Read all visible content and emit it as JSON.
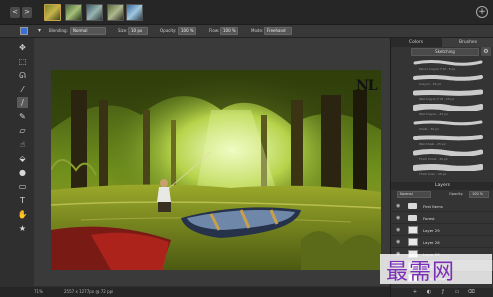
{
  "doc_strip": {
    "nav_left": "<",
    "nav_right": ">",
    "add_document": "+"
  },
  "options": {
    "blending_label": "Blending:",
    "blending_value": "Normal",
    "size_label": "Size:",
    "size_value": "10 px",
    "opacity_label": "Opacity:",
    "opacity_value": "100 %",
    "flow_label": "Flow:",
    "flow_value": "100 %",
    "mode_label": "Mode:",
    "mode_value": "Freehand",
    "accent_color": "#3a6fd8"
  },
  "tools": [
    "move-icon",
    "marquee-icon",
    "lasso-icon",
    "eyedropper-icon",
    "brush-icon",
    "pencil-icon",
    "eraser-icon",
    "smudge-icon",
    "fill-icon",
    "dodge-icon",
    "gradient-icon",
    "text-icon",
    "hand-icon",
    "star-icon"
  ],
  "status": {
    "zoom": "71%",
    "dimensions": "2557 x 1277px @ 72 ppi"
  },
  "panel": {
    "tabs": [
      "Colors",
      "Brushes"
    ],
    "active_tab": "Brushes",
    "brush_set": "Sketching",
    "brushes": [
      {
        "name": "Pencil Crayon F-M - 8 px"
      },
      {
        "name": "Crayon - 25 px"
      },
      {
        "name": "Wet Crayon F-M - 25 px"
      },
      {
        "name": "Wet Crayon - 25 px"
      },
      {
        "name": "Chalk - 30 px"
      },
      {
        "name": "Wet Chalk - 25 px"
      },
      {
        "name": "Thick Chalk - 30 px"
      },
      {
        "name": "Thick Crax - 25 px"
      }
    ],
    "layers_title": "Layers",
    "layer_blend": "Normal",
    "layer_opacity_label": "Opacity:",
    "layer_opacity": "100 %",
    "layers": [
      {
        "name": "First Items",
        "type": "folder"
      },
      {
        "name": "Forest",
        "type": "folder"
      },
      {
        "name": "Layer 29",
        "type": "layer"
      },
      {
        "name": "Layer 28",
        "type": "layer"
      },
      {
        "name": "Layer 26",
        "type": "layer"
      },
      {
        "name": "Layer 27",
        "type": "layer",
        "selected": true
      },
      {
        "name": "Layer 1 copy",
        "type": "layer"
      }
    ]
  },
  "canvas": {
    "signature": "NL"
  },
  "watermark": {
    "text": "最需网"
  }
}
